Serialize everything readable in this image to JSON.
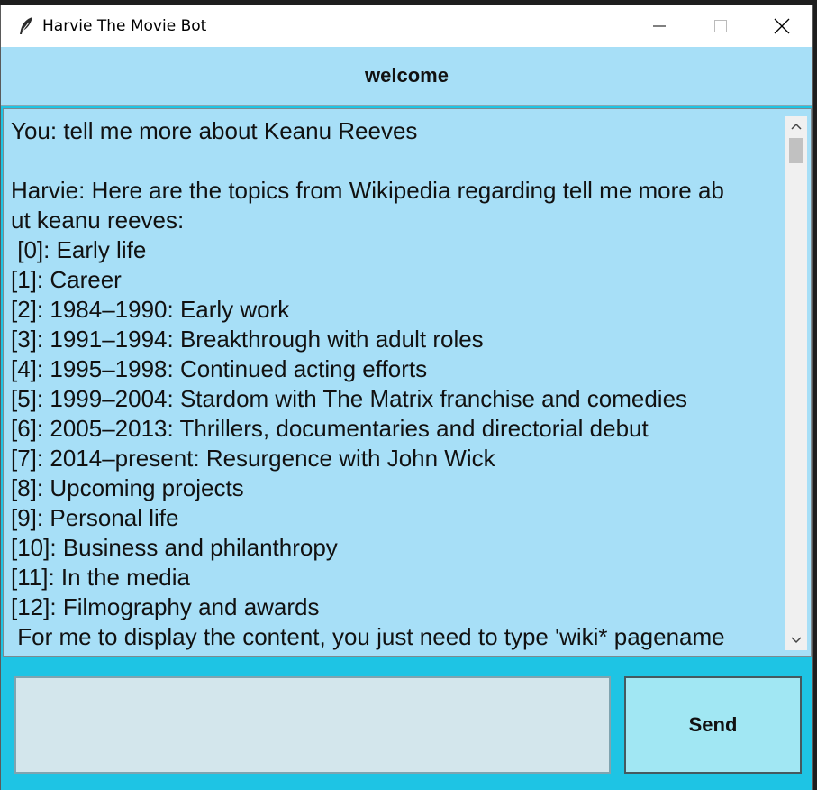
{
  "window": {
    "title": "Harvie The Movie Bot",
    "icon": "feather-icon"
  },
  "header": {
    "title": "welcome"
  },
  "chat": {
    "log": "You: tell me more about Keanu Reeves\n\nHarvie: Here are the topics from Wikipedia regarding tell me more ab\nut keanu reeves:\n [0]: Early life\n[1]: Career\n[2]: 1984–1990: Early work\n[3]: 1991–1994: Breakthrough with adult roles\n[4]: 1995–1998: Continued acting efforts\n[5]: 1999–2004: Stardom with The Matrix franchise and comedies\n[6]: 2005–2013: Thrillers, documentaries and directorial debut\n[7]: 2014–present: Resurgence with John Wick\n[8]: Upcoming projects\n[9]: Personal life\n[10]: Business and philanthropy\n[11]: In the media\n[12]: Filmography and awards\n For me to display the content, you just need to type 'wiki* pagename"
  },
  "input": {
    "value": "",
    "placeholder": ""
  },
  "send": {
    "label": "Send"
  },
  "colors": {
    "window_bg": "#1ec4e4",
    "panel_bg": "#a7dff7",
    "input_bg": "#d3e6ec",
    "button_bg": "#a1e7f3"
  }
}
